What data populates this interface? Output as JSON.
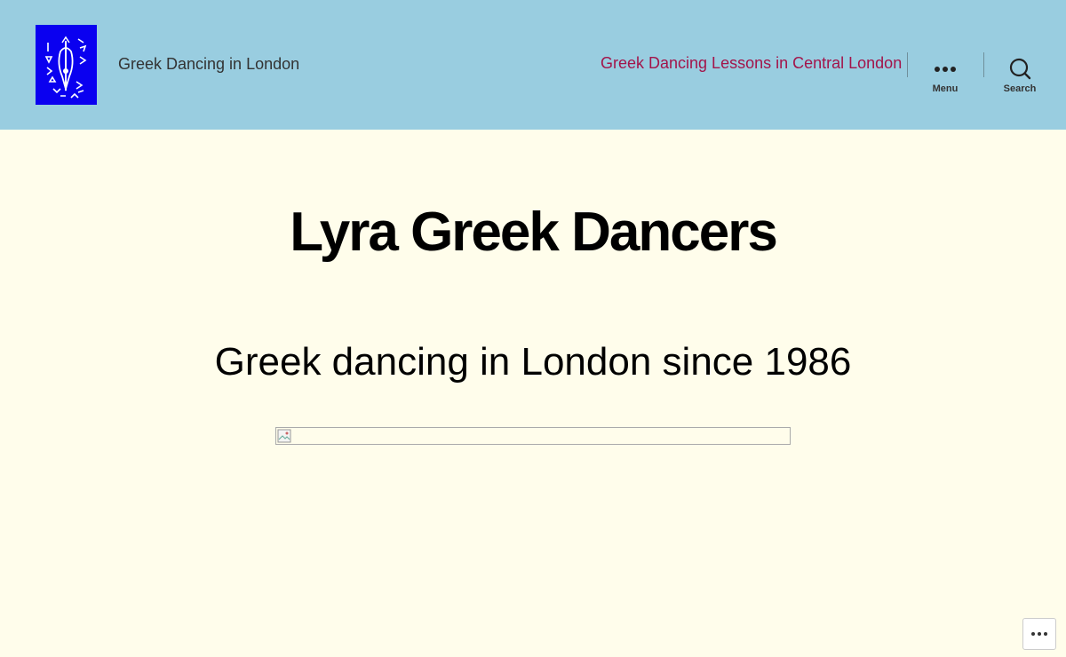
{
  "header": {
    "logo_name": "Lyra Greek Dancers logo",
    "site_description": "Greek Dancing in London",
    "primary_nav_link": "Greek Dancing Lessons in Central London",
    "menu_label": "Menu",
    "search_label": "Search"
  },
  "main": {
    "title": "Lyra Greek Dancers",
    "subtitle": "Greek dancing in London since 1986"
  },
  "colors": {
    "header_bg": "#99cde0",
    "page_bg": "#fffdeb",
    "link": "#a3144a",
    "logo_bg": "#0a00f0"
  },
  "icons": {
    "menu": "ellipsis-icon",
    "search": "search-icon",
    "more": "more-options-icon",
    "image": "broken-image-icon"
  }
}
